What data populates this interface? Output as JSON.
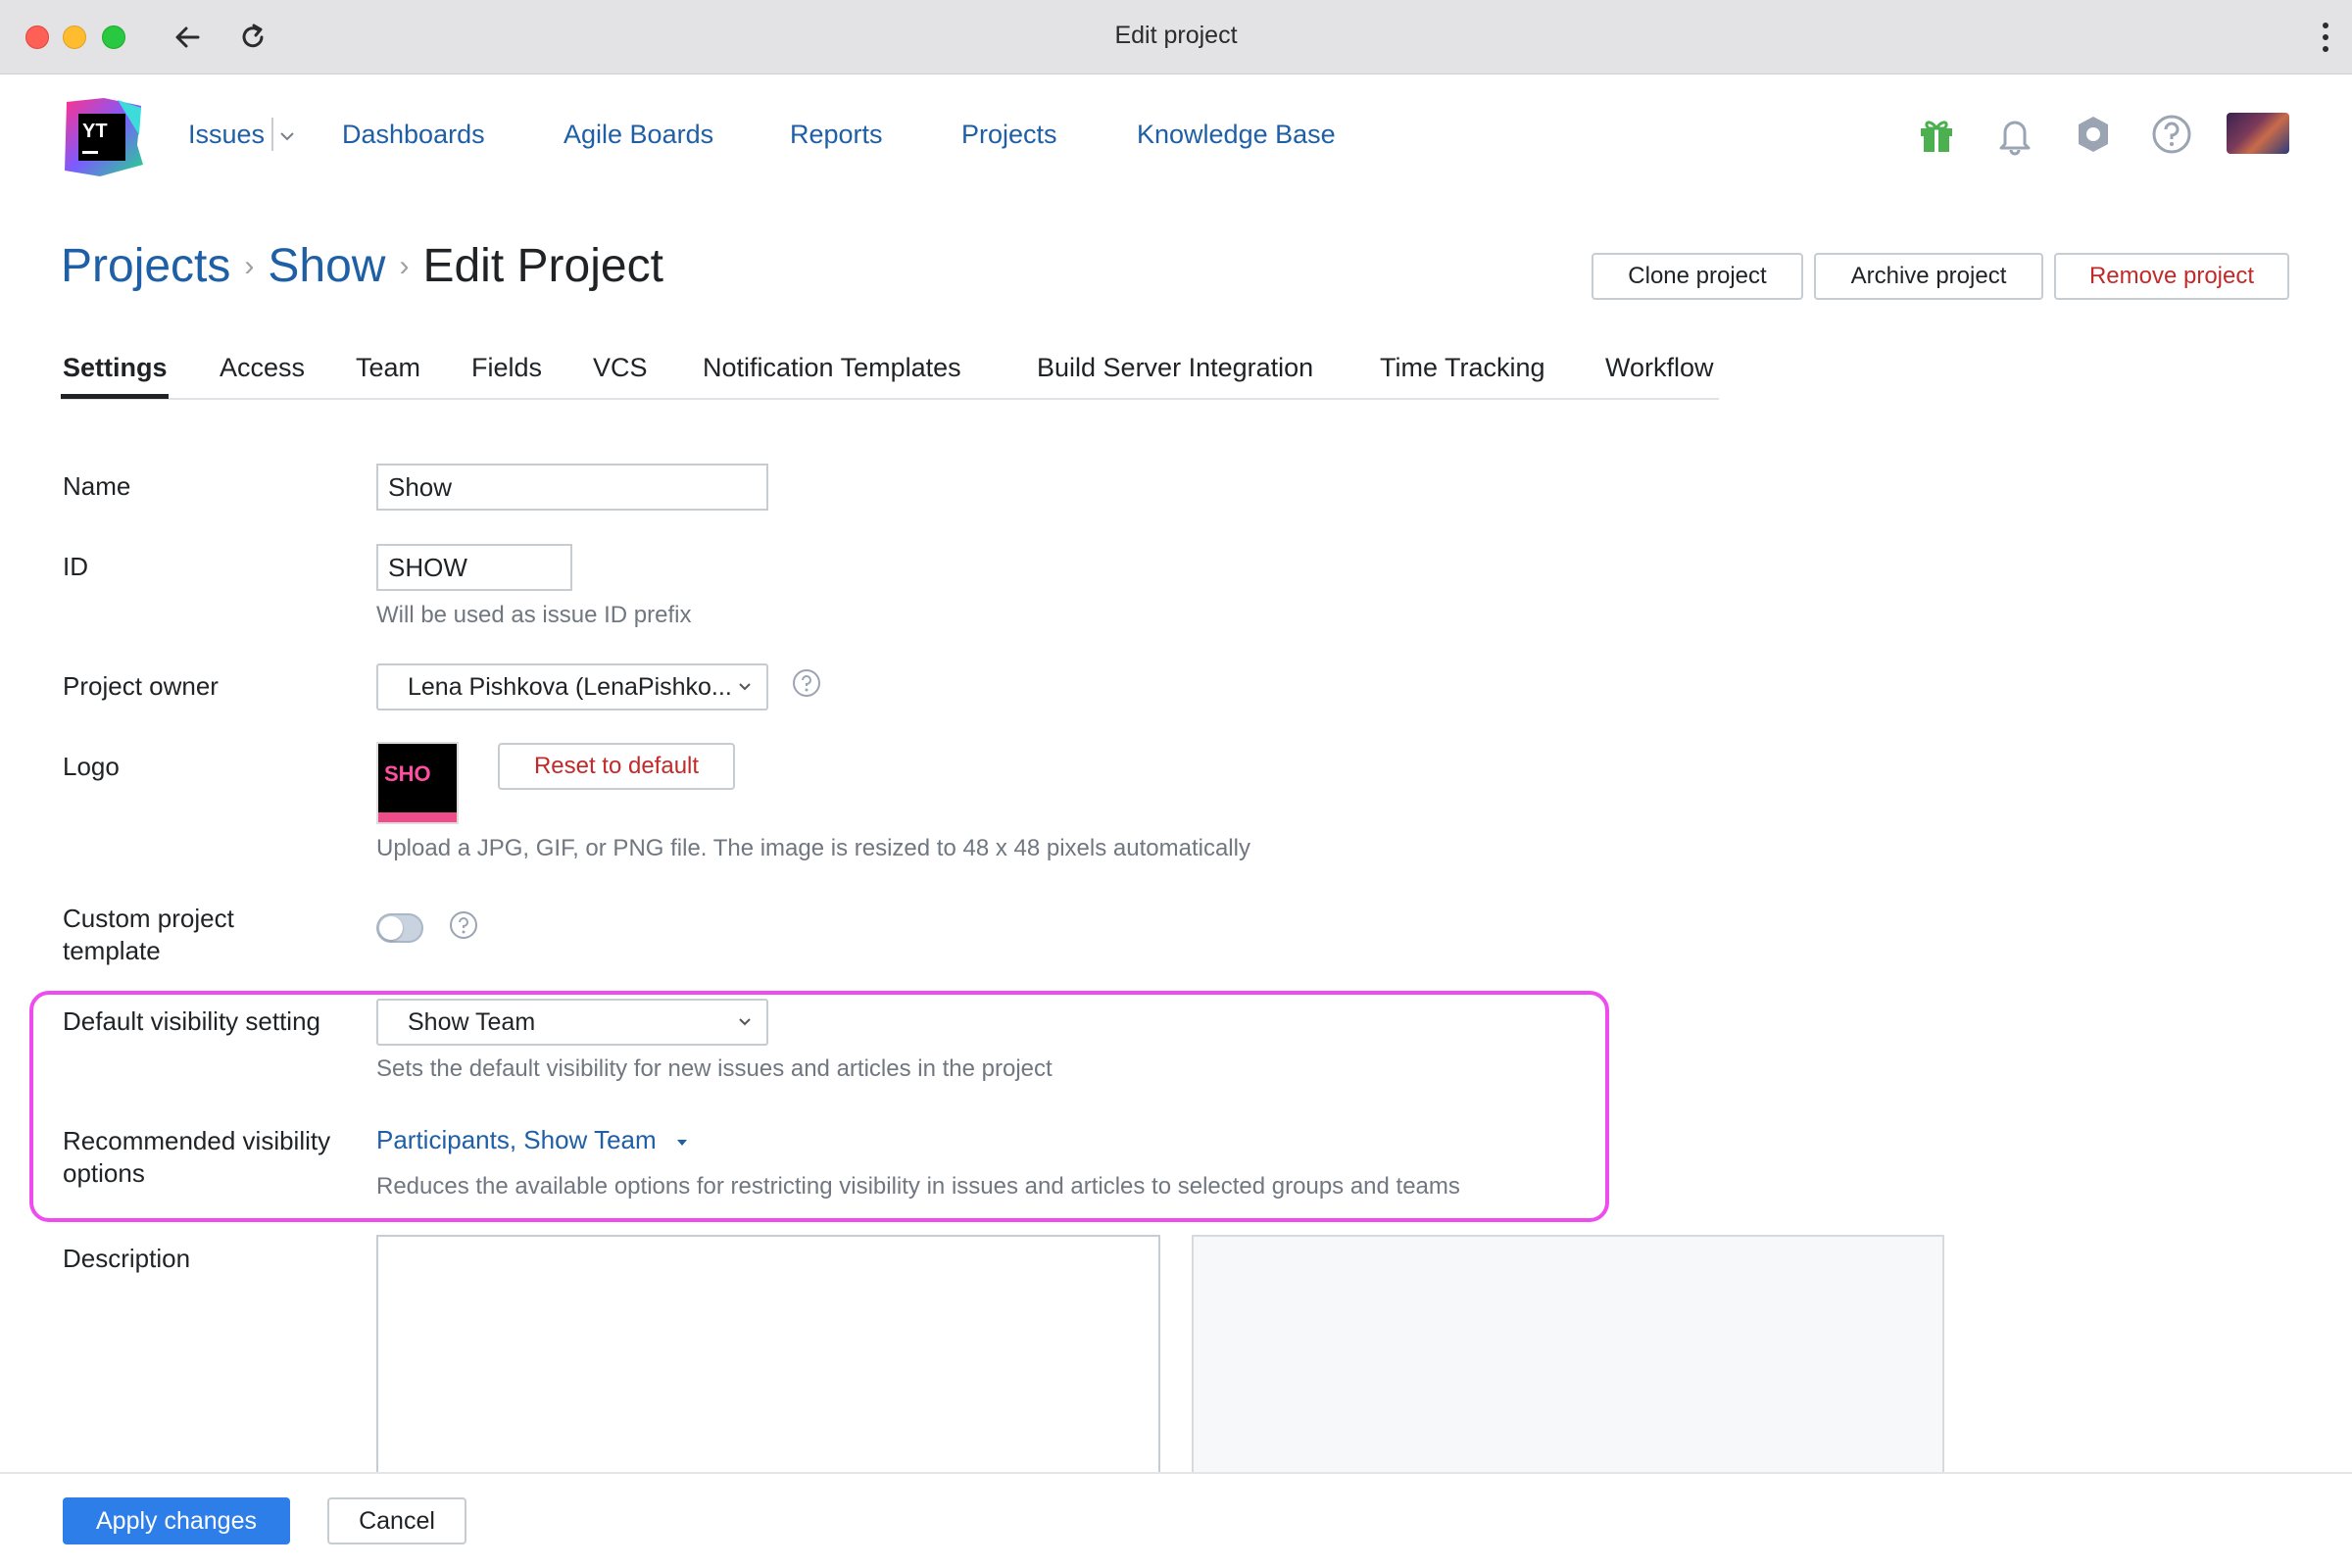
{
  "window": {
    "title": "Edit project"
  },
  "nav": {
    "items": [
      "Issues",
      "Dashboards",
      "Agile Boards",
      "Reports",
      "Projects",
      "Knowledge Base"
    ],
    "logo_text": "YT"
  },
  "breadcrumb": {
    "projects": "Projects",
    "project": "Show",
    "current": "Edit Project"
  },
  "header_actions": {
    "clone": "Clone project",
    "archive": "Archive project",
    "remove": "Remove project"
  },
  "tabs": [
    "Settings",
    "Access",
    "Team",
    "Fields",
    "VCS",
    "Notification Templates",
    "Build Server Integration",
    "Time Tracking",
    "Workflow"
  ],
  "form": {
    "name": {
      "label": "Name",
      "value": "Show"
    },
    "id": {
      "label": "ID",
      "value": "SHOW",
      "hint": "Will be used as issue ID prefix"
    },
    "owner": {
      "label": "Project owner",
      "value": "Lena Pishkova (LenaPishko..."
    },
    "logo": {
      "label": "Logo",
      "preview_text": "SHO",
      "reset_label": "Reset to default",
      "hint": "Upload a JPG, GIF, or PNG file. The image is resized to 48 x 48 pixels automatically"
    },
    "template": {
      "label": "Custom project template",
      "enabled": false
    },
    "default_visibility": {
      "label": "Default visibility setting",
      "value": "Show Team",
      "hint": "Sets the default visibility for new issues and articles in the project"
    },
    "recommended_visibility": {
      "label": "Recommended visibility options",
      "value": "Participants, Show Team",
      "hint": "Reduces the available options for restricting visibility in issues and articles to selected groups and teams"
    },
    "description": {
      "label": "Description",
      "value": ""
    }
  },
  "footer": {
    "apply": "Apply changes",
    "cancel": "Cancel"
  },
  "colors": {
    "link": "#1e5fa6",
    "danger": "#c22a2a",
    "primary_button": "#2d7ee8",
    "highlight": "#ee4cee",
    "gift_icon": "#4caf50"
  }
}
